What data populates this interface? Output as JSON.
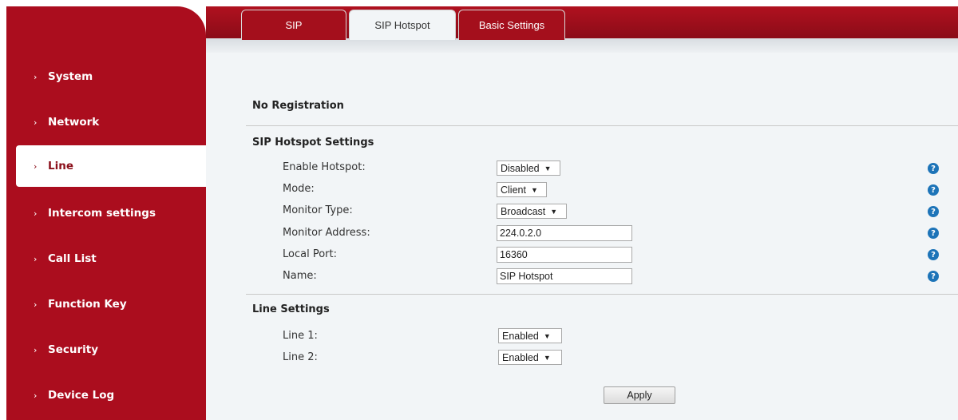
{
  "sidebar": {
    "items": [
      {
        "label": "System",
        "active": false
      },
      {
        "label": "Network",
        "active": false
      },
      {
        "label": "Line",
        "active": true
      },
      {
        "label": "Intercom settings",
        "active": false
      },
      {
        "label": "Call List",
        "active": false
      },
      {
        "label": "Function Key",
        "active": false
      },
      {
        "label": "Security",
        "active": false
      },
      {
        "label": "Device Log",
        "active": false
      }
    ],
    "chevron": "›"
  },
  "tabs": [
    {
      "label": "SIP",
      "active": false
    },
    {
      "label": "SIP Hotspot",
      "active": true
    },
    {
      "label": "Basic Settings",
      "active": false
    }
  ],
  "status": {
    "registration": "No Registration"
  },
  "hotspot": {
    "title": "SIP Hotspot Settings",
    "enable_label": "Enable Hotspot:",
    "enable_value": "Disabled",
    "mode_label": "Mode:",
    "mode_value": "Client",
    "monitor_type_label": "Monitor Type:",
    "monitor_type_value": "Broadcast",
    "monitor_address_label": "Monitor Address:",
    "monitor_address_value": "224.0.2.0",
    "local_port_label": "Local Port:",
    "local_port_value": "16360",
    "name_label": "Name:",
    "name_value": "SIP Hotspot"
  },
  "line_settings": {
    "title": "Line Settings",
    "line1_label": "Line 1:",
    "line1_value": "Enabled",
    "line2_label": "Line 2:",
    "line2_value": "Enabled"
  },
  "actions": {
    "apply_label": "Apply"
  },
  "icons": {
    "help": "help-icon",
    "dropdown": "dropdown-arrow-icon",
    "chevron": "chevron-right-icon"
  },
  "colors": {
    "brand_red": "#ab0d1e",
    "help_blue": "#1d74b8",
    "content_bg": "#f2f5f7"
  }
}
